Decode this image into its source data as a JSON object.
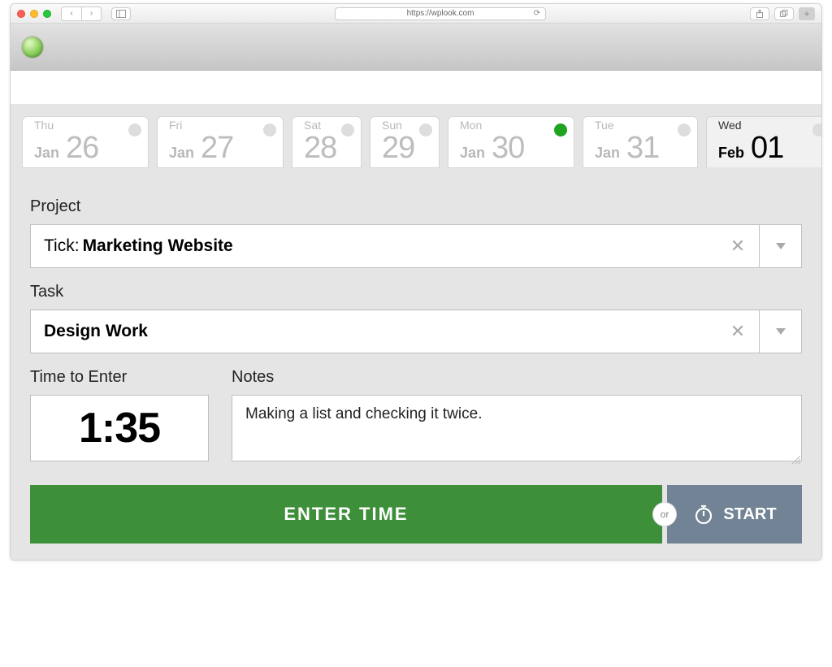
{
  "browser": {
    "url": "https://wplook.com"
  },
  "dates": [
    {
      "dow": "Thu",
      "mon": "Jan",
      "num": "26",
      "today": false,
      "selected": false,
      "cls": "w0"
    },
    {
      "dow": "Fri",
      "mon": "Jan",
      "num": "27",
      "today": false,
      "selected": false,
      "cls": "w1"
    },
    {
      "dow": "Sat",
      "mon": "",
      "num": "28",
      "today": false,
      "selected": false,
      "cls": "w2"
    },
    {
      "dow": "Sun",
      "mon": "",
      "num": "29",
      "today": false,
      "selected": false,
      "cls": "w3"
    },
    {
      "dow": "Mon",
      "mon": "Jan",
      "num": "30",
      "today": true,
      "selected": false,
      "cls": "w4"
    },
    {
      "dow": "Tue",
      "mon": "Jan",
      "num": "31",
      "today": false,
      "selected": false,
      "cls": "w5"
    },
    {
      "dow": "Wed",
      "mon": "Feb",
      "num": "01",
      "today": false,
      "selected": true,
      "cls": "w6"
    }
  ],
  "labels": {
    "project": "Project",
    "task": "Task",
    "time": "Time to Enter",
    "notes": "Notes",
    "enter": "ENTER TIME",
    "or": "or",
    "start": "START"
  },
  "project": {
    "prefix": "Tick:",
    "value": "Marketing Website"
  },
  "task": {
    "value": "Design Work"
  },
  "time_value": "1:35",
  "notes_value": "Making a list and checking it twice."
}
